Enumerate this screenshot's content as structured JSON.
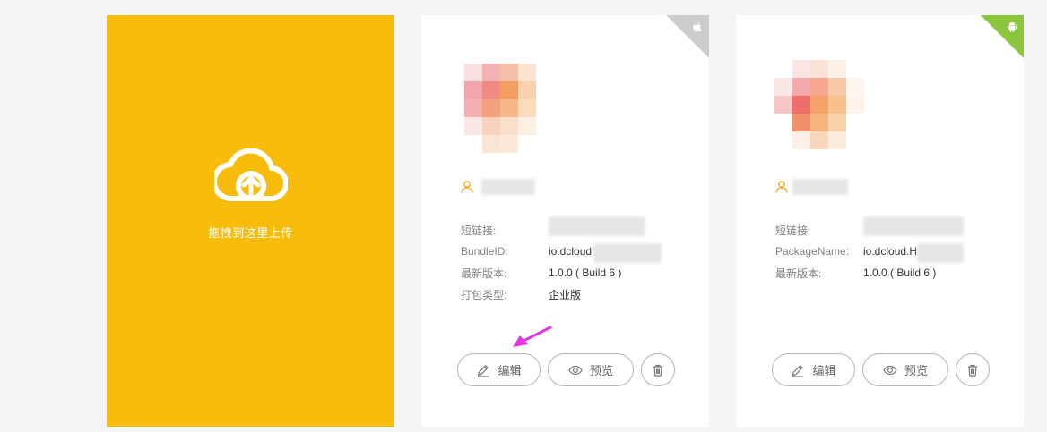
{
  "upload": {
    "label": "拖拽到这里上传",
    "icon": "cloud-upload-icon"
  },
  "apps": [
    {
      "platform": "ios",
      "platform_icon": "apple-icon",
      "fields": [
        {
          "key": "短链接:",
          "value": ""
        },
        {
          "key": "BundleID:",
          "value": "io.dcloud"
        },
        {
          "key": "最新版本:",
          "value": "1.0.0 ( Build 6 )"
        },
        {
          "key": "打包类型:",
          "value": "企业版"
        }
      ],
      "buttons": {
        "edit": "编辑",
        "preview": "预览"
      }
    },
    {
      "platform": "android",
      "platform_icon": "android-icon",
      "fields": [
        {
          "key": "短链接:",
          "value": ""
        },
        {
          "key": "PackageName:",
          "value": "io.dcloud.H"
        },
        {
          "key": "最新版本:",
          "value": "1.0.0 ( Build 6 )"
        }
      ],
      "buttons": {
        "edit": "编辑",
        "preview": "预览"
      }
    }
  ],
  "colors": {
    "upload_bg": "#f8bc0c",
    "ios_corner": "#cccccc",
    "android_corner": "#8cc63e",
    "annotation_arrow": "#e633e6",
    "owner_icon": "#f5a623"
  }
}
